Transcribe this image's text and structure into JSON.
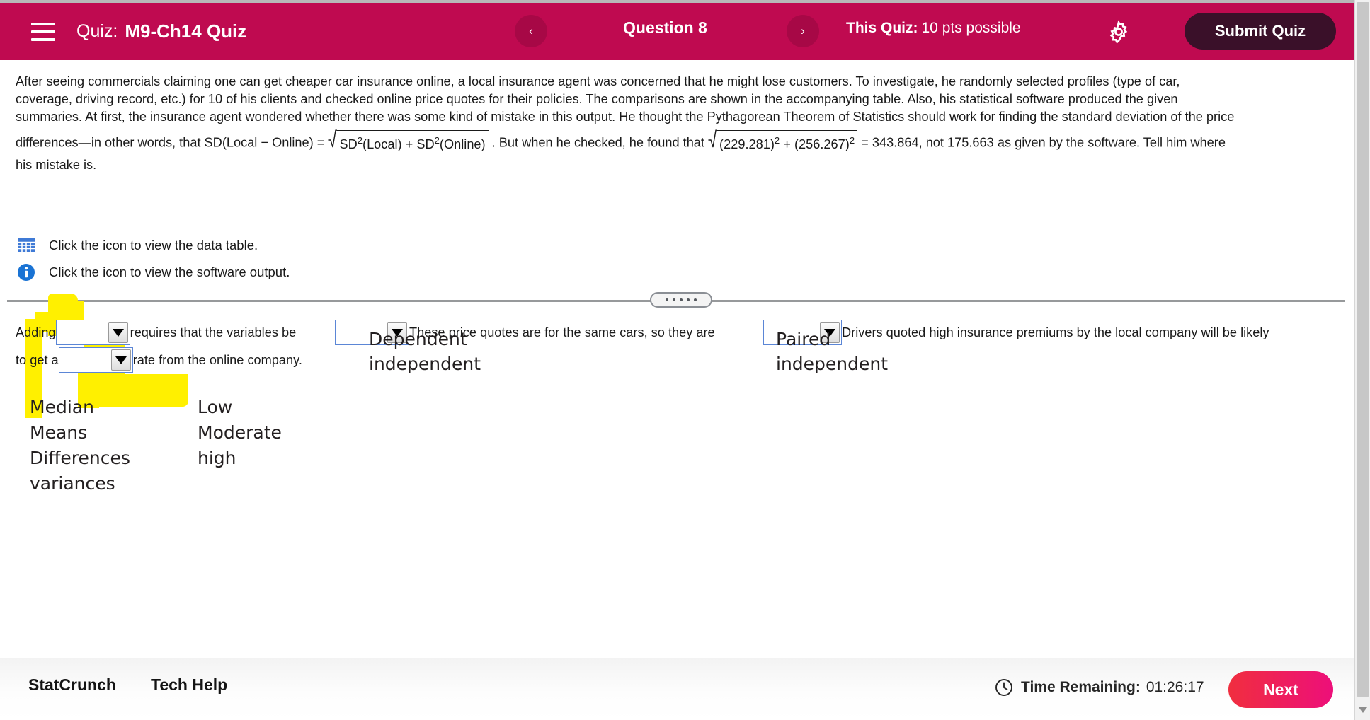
{
  "header": {
    "menu_icon": "hamburger-icon",
    "quiz_prefix": "Quiz:",
    "quiz_name": "M9-Ch14 Quiz",
    "prev_label": "‹",
    "next_label": "›",
    "question_label": "Question 8",
    "quiz_points_prefix": "This Quiz:",
    "quiz_points_value": "10 pts possible",
    "settings_icon": "gear-icon",
    "submit_label": "Submit Quiz",
    "bg_color": "#bf0a50",
    "submit_bg_color": "#3a1029"
  },
  "question": {
    "lines": [
      "After seeing commercials claiming one can get cheaper car insurance online, a local insurance agent was concerned that he might lose customers. To investigate, he randomly selected profiles (type of car,",
      "coverage, driving record, etc.) for 10 of his clients and checked online price quotes for their policies. The comparisons are shown in the accompanying table. Also, his statistical software produced the given",
      "summaries. At first, the insurance agent wondered whether there was some kind of mistake in this output. He thought the Pythagorean Theorem of Statistics should work for finding the standard deviation of the price"
    ],
    "formula": {
      "pre": "differences—in other words, that SD(Local − Online) =",
      "radicand_a": "SD",
      "radicand_a_arg": "(Local)",
      "plus": "+",
      "radicand_b": "SD",
      "radicand_b_arg": "(Online)",
      "mid": ". But when he checked, he found that",
      "num_a": "(229.281)",
      "num_plus": "+",
      "num_b": "(256.267)",
      "post": "= 343.864, not 175.663 as given by the software. Tell him where",
      "exponent": "2"
    },
    "last_line": "his mistake is.",
    "links": [
      {
        "icon": "table-icon",
        "text": "Click the icon to view the data table.",
        "color": "#3f7ad6"
      },
      {
        "icon": "info-icon",
        "text": "Click the icon to view the software output.",
        "color": "#1a73d4"
      }
    ]
  },
  "splitter": {
    "handle_icon": "drag-handle-dots",
    "dots": 5
  },
  "answer": {
    "seg1_pre": "Adding",
    "dropdown1": {
      "name": "dropdown-adding",
      "value": ""
    },
    "seg1_post": "requires that the variables be",
    "dropdown2": {
      "name": "dropdown-variables",
      "value": ""
    },
    "seg2": "These price quotes are for the same cars, so they are",
    "dropdown3": {
      "name": "dropdown-paired",
      "value": ""
    },
    "seg3": "Drivers quoted high insurance premiums by the local company will be likely",
    "line2_pre": "to get a",
    "dropdown4": {
      "name": "dropdown-rate",
      "value": ""
    },
    "line2_post": "rate from the online company."
  },
  "annotations": {
    "col1": [
      "Median",
      "Means",
      "Differences",
      "variances"
    ],
    "col2": [
      "Low",
      "Moderate",
      "high"
    ],
    "opts_dependent": [
      "Dependent",
      "independent"
    ],
    "opts_paired": [
      "Paired",
      "independent"
    ],
    "highlight_color": "#fff000"
  },
  "footer": {
    "statcrunch": "StatCrunch",
    "tech_help": "Tech Help",
    "clock_icon": "clock-icon",
    "time_label": "Time Remaining:",
    "time_value": "01:26:17",
    "next_label": "Next",
    "next_gradient_from": "#f02e3f",
    "next_gradient_to": "#ed0f7a"
  }
}
